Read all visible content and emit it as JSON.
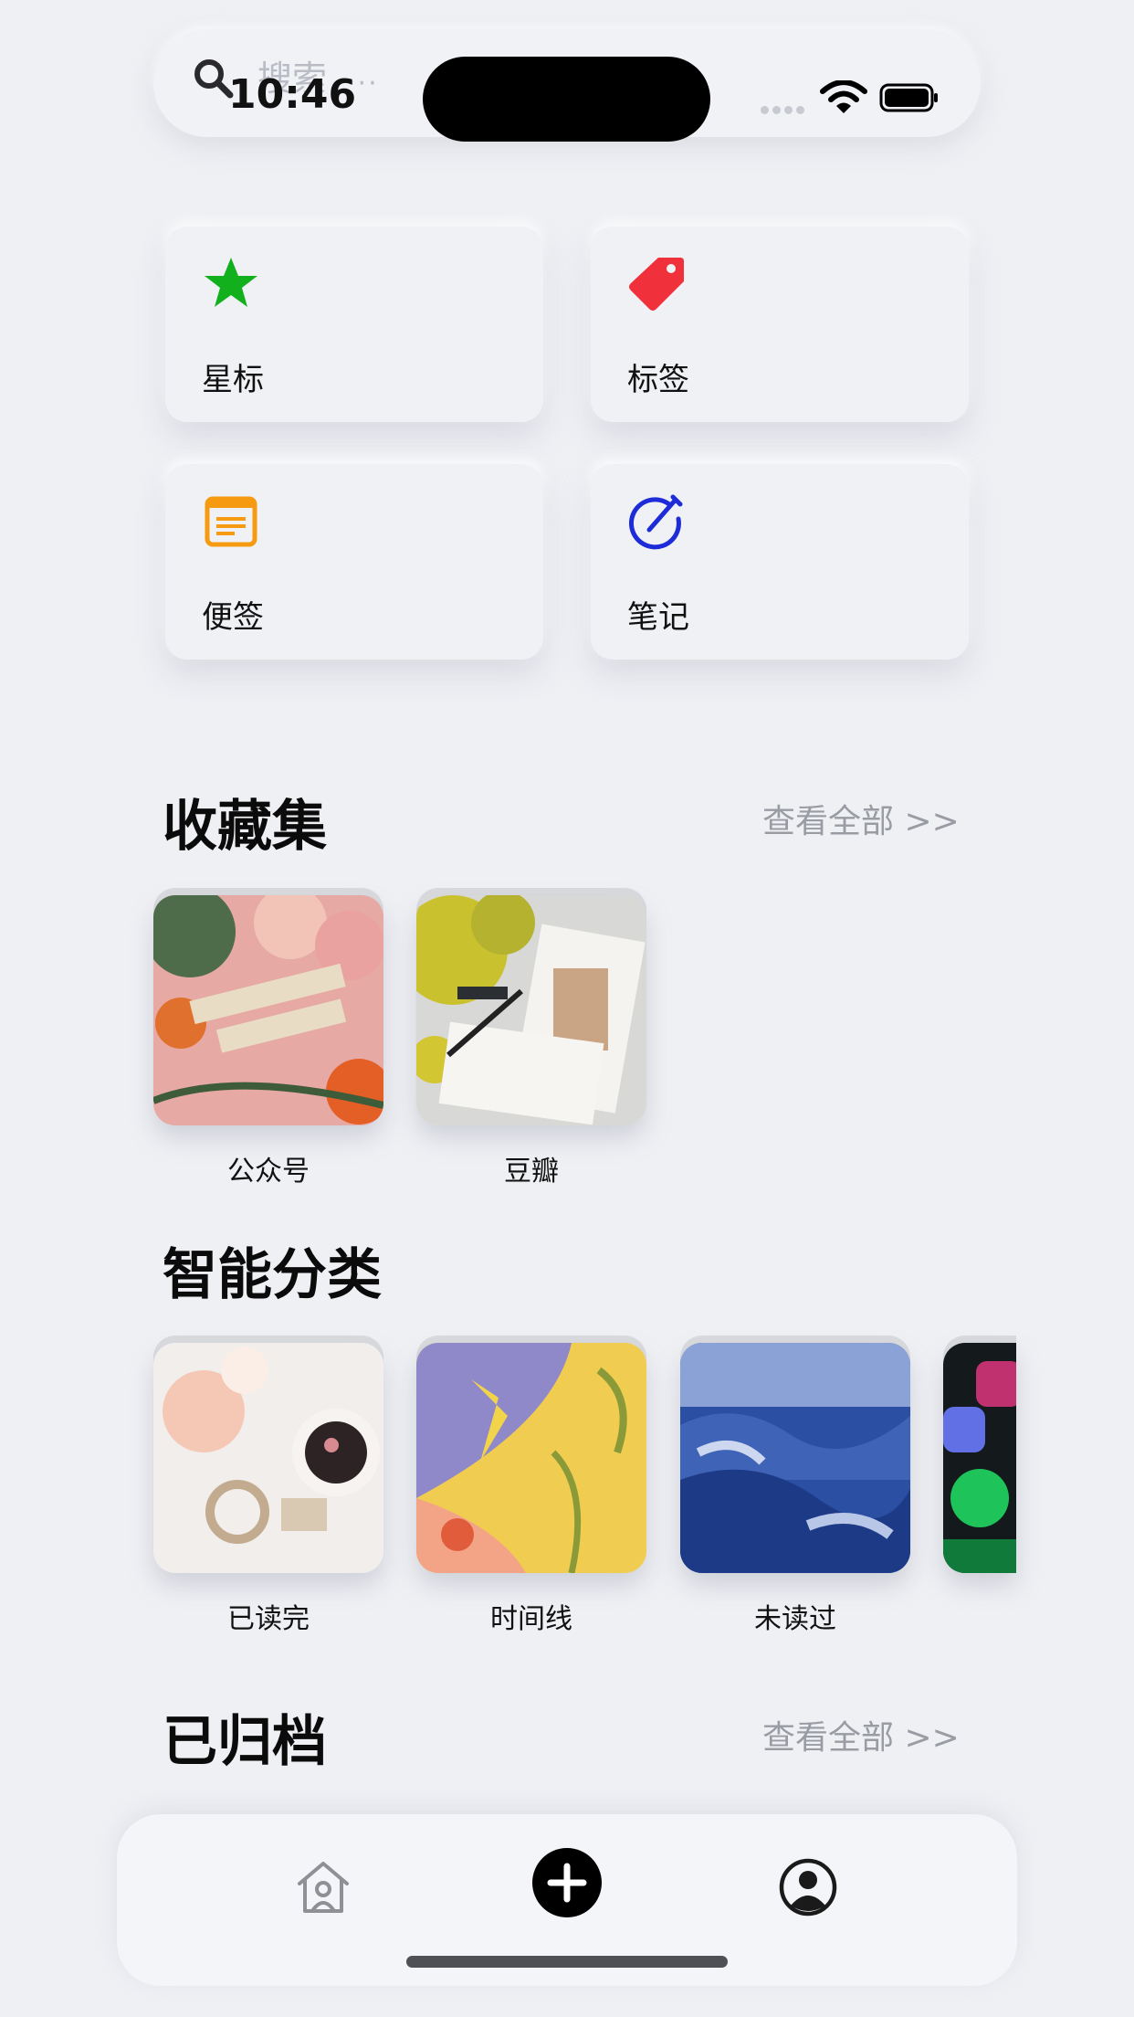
{
  "status_bar": {
    "time": "10:46"
  },
  "search": {
    "placeholder": "搜索",
    "ellipsis": "···"
  },
  "quick_actions": [
    {
      "label": "星标",
      "icon": "star-icon",
      "color": "#11b01c"
    },
    {
      "label": "标签",
      "icon": "tag-icon",
      "color": "#f0303b"
    },
    {
      "label": "便签",
      "icon": "memo-icon",
      "color": "#f59a11"
    },
    {
      "label": "笔记",
      "icon": "note-pen-icon",
      "color": "#1d2bd8"
    }
  ],
  "favorites": {
    "title": "收藏集",
    "view_all": "查看全部 >>",
    "items": [
      {
        "label": "公众号",
        "image": "welcome-spring-photo"
      },
      {
        "label": "豆瓣",
        "image": "paint-brushes-photo"
      }
    ]
  },
  "smart_categories": {
    "title": "智能分类",
    "items": [
      {
        "label": "已读完",
        "image": "candle-tea-photo"
      },
      {
        "label": "时间线",
        "image": "floral-pattern-illustration"
      },
      {
        "label": "未读过",
        "image": "blue-mountains-photo"
      },
      {
        "label": "",
        "image": "social-app-icons-photo"
      }
    ]
  },
  "archived": {
    "title": "已归档",
    "view_all": "查看全部 >>"
  },
  "tabbar": {
    "items": [
      {
        "icon": "home-icon"
      },
      {
        "icon": "add-icon"
      },
      {
        "icon": "profile-icon"
      }
    ]
  }
}
